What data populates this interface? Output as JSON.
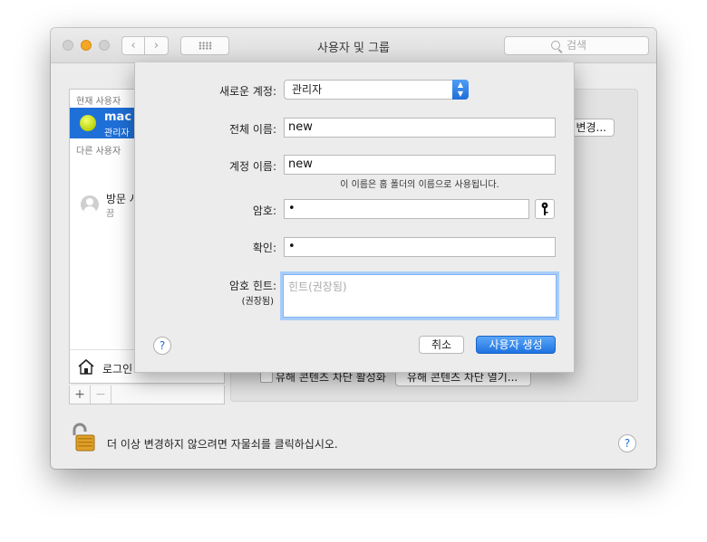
{
  "window": {
    "title": "사용자 및 그룹",
    "nav_back": "‹",
    "nav_forward": "›",
    "search_placeholder": "검색"
  },
  "sidebar": {
    "current_users_label": "현재 사용자",
    "current_user": {
      "name": "mac",
      "role": "관리자"
    },
    "other_users_label": "다른 사용자",
    "guest": {
      "name": "방문 사",
      "status": "끔"
    },
    "login_options": "로그인",
    "add": "+",
    "remove": "−"
  },
  "background": {
    "change_button": "변경...",
    "parental_check_label": "유해 콘텐츠 차단 활성화",
    "parental_open_button": "유해 콘텐츠 차단 열기..."
  },
  "lock": {
    "text": "더 이상 변경하지 않으려면 자물쇠를 클릭하십시오."
  },
  "help_glyph": "?",
  "sheet": {
    "new_account_label": "새로운 계정:",
    "new_account_value": "관리자",
    "full_name_label": "전체 이름:",
    "full_name_value": "new",
    "account_name_label": "계정 이름:",
    "account_name_value": "new",
    "account_name_note": "이 이름은 홈 폴더의 이름으로 사용됩니다.",
    "password_label": "암호:",
    "password_value": "•",
    "verify_label": "확인:",
    "verify_value": "•",
    "hint_label": "암호 힌트:",
    "hint_sublabel": "(권장됨)",
    "hint_placeholder": "힌트(권장됨)",
    "cancel": "취소",
    "create": "사용자 생성"
  },
  "colors": {
    "accent": "#1f6fd8",
    "minimize": "#f5a623",
    "lock_gold": "#e0a128"
  }
}
